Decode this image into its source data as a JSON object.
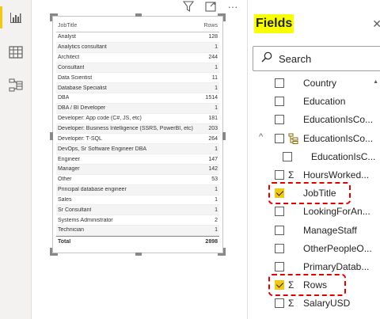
{
  "rail": {
    "icons": [
      "report-view-icon",
      "data-view-icon",
      "model-view-icon"
    ]
  },
  "visual_header": {
    "icons": [
      "filter-icon",
      "focus-mode-icon",
      "more-options-icon"
    ],
    "more_glyph": "···"
  },
  "table": {
    "columns": [
      "JobTitle",
      "Rows"
    ],
    "rows": [
      {
        "job": "Analyst",
        "rows": "128"
      },
      {
        "job": "Analytics consultant",
        "rows": "1"
      },
      {
        "job": "Architect",
        "rows": "244"
      },
      {
        "job": "Consultant",
        "rows": "1"
      },
      {
        "job": "Data Scientist",
        "rows": "11"
      },
      {
        "job": "Database Specialist",
        "rows": "1"
      },
      {
        "job": "DBA",
        "rows": "1514"
      },
      {
        "job": "DBA / BI Developer",
        "rows": "1"
      },
      {
        "job": "Developer: App code (C#, JS, etc)",
        "rows": "181"
      },
      {
        "job": "Developer: Business Intelligence (SSRS, PowerBI, etc)",
        "rows": "203"
      },
      {
        "job": "Developer: T-SQL",
        "rows": "264"
      },
      {
        "job": "DevOps, Sr Software Engineer DBA",
        "rows": "1"
      },
      {
        "job": "Engineer",
        "rows": "147"
      },
      {
        "job": "Manager",
        "rows": "142"
      },
      {
        "job": "Other",
        "rows": "53"
      },
      {
        "job": "Principal database engineer",
        "rows": "1"
      },
      {
        "job": "Sales",
        "rows": "1"
      },
      {
        "job": "Sr Consultant",
        "rows": "1"
      },
      {
        "job": "Systems Administrator",
        "rows": "2"
      },
      {
        "job": "Technician",
        "rows": "1"
      }
    ],
    "total_label": "Total",
    "total_value": "2898"
  },
  "fields_pane": {
    "title": "Fields",
    "close_glyph": "✕",
    "search_placeholder": "Search",
    "items": [
      {
        "label": "Country",
        "checked": false,
        "sigma": false
      },
      {
        "label": "Education",
        "checked": false,
        "sigma": false
      },
      {
        "label": "EducationIsCo...",
        "checked": false,
        "sigma": false
      },
      {
        "label": "EducationIsCo...",
        "checked": false,
        "sigma": false,
        "hierarchy": true,
        "expanded": true
      },
      {
        "label": "EducationIsC...",
        "checked": false,
        "sigma": false,
        "child": true
      },
      {
        "label": "HoursWorked...",
        "checked": false,
        "sigma": true
      },
      {
        "label": "JobTitle",
        "checked": true,
        "sigma": false
      },
      {
        "label": "LookingForAn...",
        "checked": false,
        "sigma": false
      },
      {
        "label": "ManageStaff",
        "checked": false,
        "sigma": false
      },
      {
        "label": "OtherPeopleO...",
        "checked": false,
        "sigma": false
      },
      {
        "label": "PrimaryDatab...",
        "checked": false,
        "sigma": false
      },
      {
        "label": "Rows",
        "checked": true,
        "sigma": true
      },
      {
        "label": "SalaryUSD",
        "checked": false,
        "sigma": true
      }
    ],
    "sigma_glyph": "Σ",
    "chevron_glyph": "^"
  },
  "colors": {
    "accent": "#f2c811",
    "highlight_box": "#e00000",
    "title_highlight": "#f7ff00"
  }
}
